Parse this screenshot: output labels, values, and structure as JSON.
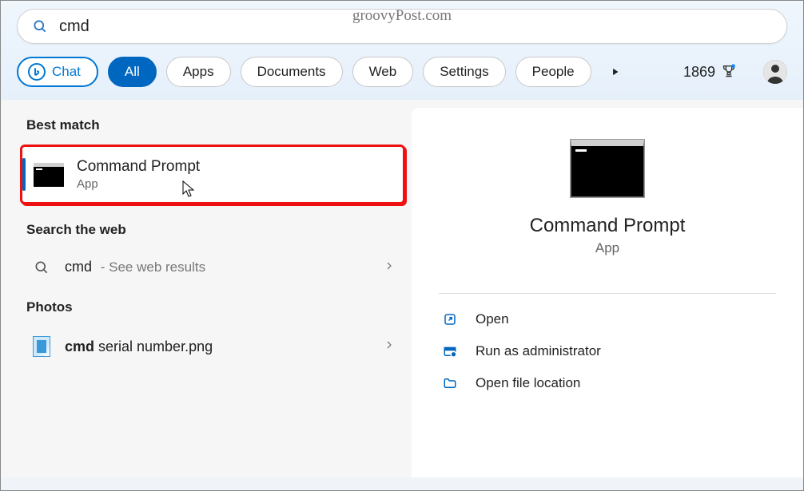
{
  "watermark": "groovyPost.com",
  "search": {
    "query": "cmd",
    "placeholder": ""
  },
  "filters": {
    "chat": "Chat",
    "items": [
      "All",
      "Apps",
      "Documents",
      "Web",
      "Settings",
      "People"
    ],
    "active_index": 0
  },
  "rewards": {
    "points": "1869"
  },
  "left": {
    "best_match_label": "Best match",
    "best_match": {
      "title": "Command Prompt",
      "subtitle": "App"
    },
    "search_web_label": "Search the web",
    "web_item": {
      "term": "cmd",
      "hint": "See web results"
    },
    "photos_label": "Photos",
    "photo_item": {
      "bold": "cmd",
      "rest": " serial number.png"
    }
  },
  "details": {
    "title": "Command Prompt",
    "subtitle": "App",
    "actions": {
      "open": "Open",
      "run_admin": "Run as administrator",
      "open_location": "Open file location"
    }
  }
}
